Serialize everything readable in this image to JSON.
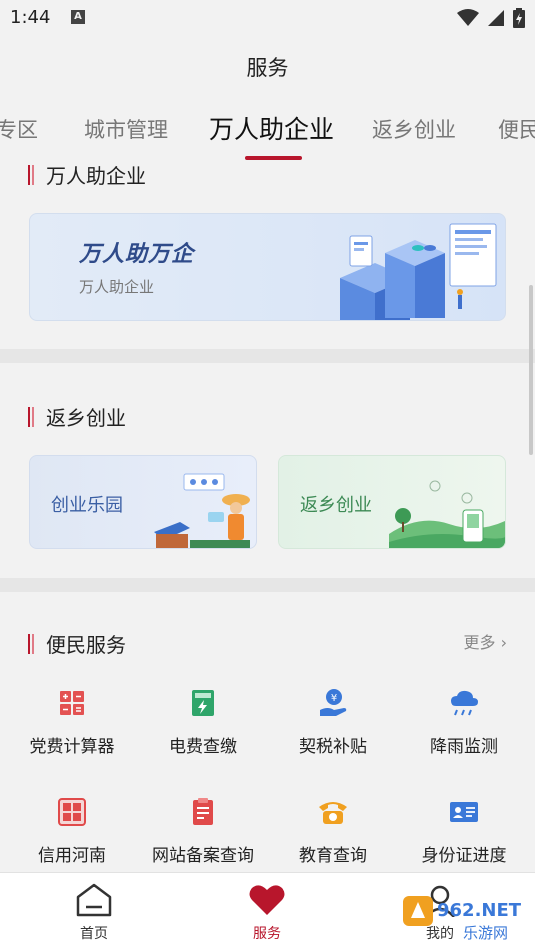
{
  "status_bar": {
    "time": "1:44",
    "notification_glyph": "A"
  },
  "header": {
    "title": "服务"
  },
  "tabs": [
    {
      "label": "专区"
    },
    {
      "label": "城市管理"
    },
    {
      "label": "万人助企业"
    },
    {
      "label": "返乡创业"
    },
    {
      "label": "便民"
    }
  ],
  "active_tab_index": 2,
  "sections": {
    "wanren": {
      "title": "万人助企业",
      "banner": {
        "title": "万人助万企",
        "subtitle": "万人助企业"
      }
    },
    "fanxiang": {
      "title": "返乡创业",
      "cards": [
        {
          "label": "创业乐园"
        },
        {
          "label": "返乡创业"
        }
      ]
    },
    "bianmin": {
      "title": "便民服务",
      "more_label": "更多",
      "items": [
        {
          "label": "党费计算器",
          "icon": "calculator-icon"
        },
        {
          "label": "电费查缴",
          "icon": "electricity-meter-icon"
        },
        {
          "label": "契税补贴",
          "icon": "tax-subsidy-icon"
        },
        {
          "label": "降雨监测",
          "icon": "rain-cloud-icon"
        },
        {
          "label": "信用河南",
          "icon": "credit-seal-icon"
        },
        {
          "label": "网站备案查询",
          "icon": "clipboard-icon"
        },
        {
          "label": "教育查询",
          "icon": "telephone-icon"
        },
        {
          "label": "身份证进度",
          "icon": "id-card-icon"
        }
      ]
    }
  },
  "bottom_nav": [
    {
      "label": "首页",
      "icon": "home-icon"
    },
    {
      "label": "服务",
      "icon": "heart-icon"
    },
    {
      "label": "我的",
      "icon": "user-icon"
    }
  ],
  "watermark": {
    "text_top": "962.NET",
    "text_bottom": "乐游网"
  },
  "colors": {
    "accent": "#b8162c",
    "bg": "#f2f2f2",
    "icon_red": "#e04a4a",
    "icon_green": "#2fa56a",
    "icon_blue": "#3a78d8",
    "icon_orange": "#f0a020"
  }
}
